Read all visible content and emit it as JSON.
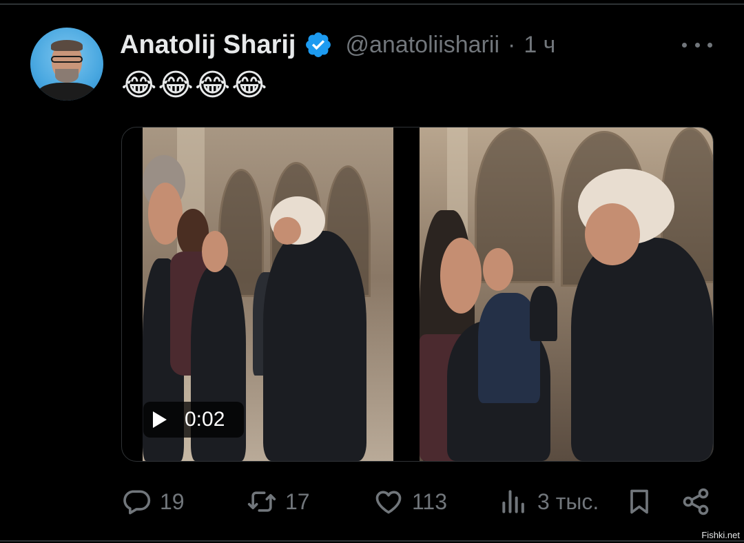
{
  "tweet": {
    "author_name": "Anatolij Sharij",
    "handle": "@anatoliisharii",
    "separator": "·",
    "time": "1 ч",
    "text": "😂😂😂😂"
  },
  "media": {
    "duration": "0:02"
  },
  "actions": {
    "replies": "19",
    "retweets": "17",
    "likes": "113",
    "views": "3 тыс."
  },
  "icons": {
    "verified": "verified-badge-icon",
    "more": "more-icon",
    "reply": "reply-icon",
    "retweet": "retweet-icon",
    "like": "like-icon",
    "views": "views-icon",
    "bookmark": "bookmark-icon",
    "share": "share-icon",
    "play": "play-icon"
  },
  "colors": {
    "background": "#000000",
    "text": "#e7e9ea",
    "muted": "#71767b",
    "verified": "#1d9bf0"
  },
  "watermark": "Fishki.net"
}
